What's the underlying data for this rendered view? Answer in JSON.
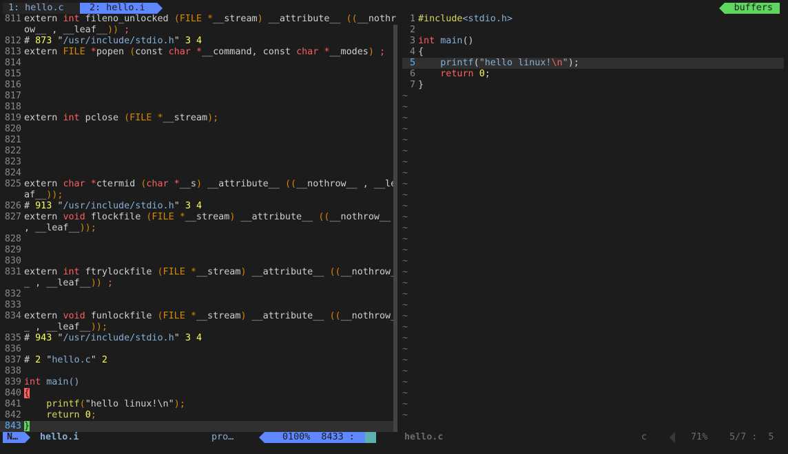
{
  "tabline": {
    "tab1": "1: hello.c",
    "tab2": "2: hello.i",
    "buffers": "buffers"
  },
  "left": {
    "lines": [
      {
        "n": "811",
        "segs": [
          [
            "id",
            "extern "
          ],
          [
            "ty",
            "int"
          ],
          [
            "id",
            " fileno_unlocked "
          ],
          [
            "paren",
            "(FILE *"
          ],
          [
            "id",
            "__stream"
          ],
          [
            "paren",
            ")"
          ],
          [
            "id",
            " __attribute__ "
          ],
          [
            "paren",
            "(("
          ],
          [
            "id",
            "__nothr"
          ]
        ]
      },
      {
        "n": "",
        "segs": [
          [
            "id",
            "ow__ , __leaf__"
          ],
          [
            "paren",
            "))"
          ],
          [
            "ty",
            " ;"
          ]
        ]
      },
      {
        "n": "812",
        "segs": [
          [
            "id",
            "# "
          ],
          [
            "num-lit",
            "873"
          ],
          [
            "id",
            " \""
          ],
          [
            "str",
            "/usr/include/stdio.h"
          ],
          [
            "id",
            "\" "
          ],
          [
            "num-lit",
            "3"
          ],
          [
            "id",
            " "
          ],
          [
            "num-lit",
            "4"
          ]
        ]
      },
      {
        "n": "813",
        "segs": [
          [
            "id",
            "extern "
          ],
          [
            "paren",
            "FILE"
          ],
          [
            "ty",
            " *"
          ],
          [
            "id",
            "popen "
          ],
          [
            "paren",
            "("
          ],
          [
            "id",
            "const "
          ],
          [
            "ty",
            "char"
          ],
          [
            "ty",
            " *"
          ],
          [
            "id",
            "__command, const "
          ],
          [
            "ty",
            "char"
          ],
          [
            "ty",
            " *"
          ],
          [
            "id",
            "__modes"
          ],
          [
            "paren",
            ")"
          ],
          [
            "ty",
            " ;"
          ]
        ]
      },
      {
        "n": "814",
        "segs": []
      },
      {
        "n": "815",
        "segs": []
      },
      {
        "n": "816",
        "segs": []
      },
      {
        "n": "817",
        "segs": []
      },
      {
        "n": "818",
        "segs": []
      },
      {
        "n": "819",
        "segs": [
          [
            "id",
            "extern "
          ],
          [
            "ty",
            "int"
          ],
          [
            "id",
            " pclose "
          ],
          [
            "paren",
            "(FILE *"
          ],
          [
            "id",
            "__stream"
          ],
          [
            "paren",
            ");"
          ]
        ]
      },
      {
        "n": "820",
        "segs": []
      },
      {
        "n": "821",
        "segs": []
      },
      {
        "n": "822",
        "segs": []
      },
      {
        "n": "823",
        "segs": []
      },
      {
        "n": "824",
        "segs": []
      },
      {
        "n": "825",
        "segs": [
          [
            "id",
            "extern "
          ],
          [
            "ty",
            "char"
          ],
          [
            "ty",
            " *"
          ],
          [
            "id",
            "ctermid "
          ],
          [
            "paren",
            "("
          ],
          [
            "ty",
            "char"
          ],
          [
            "ty",
            " *"
          ],
          [
            "id",
            "__s"
          ],
          [
            "paren",
            ")"
          ],
          [
            "id",
            " __attribute__ "
          ],
          [
            "paren",
            "(("
          ],
          [
            "id",
            "__nothrow__ , __le"
          ]
        ]
      },
      {
        "n": "",
        "segs": [
          [
            "id",
            "af__"
          ],
          [
            "paren",
            "));"
          ]
        ]
      },
      {
        "n": "826",
        "segs": [
          [
            "id",
            "# "
          ],
          [
            "num-lit",
            "913"
          ],
          [
            "id",
            " \""
          ],
          [
            "str",
            "/usr/include/stdio.h"
          ],
          [
            "id",
            "\" "
          ],
          [
            "num-lit",
            "3"
          ],
          [
            "id",
            " "
          ],
          [
            "num-lit",
            "4"
          ]
        ]
      },
      {
        "n": "827",
        "segs": [
          [
            "id",
            "extern "
          ],
          [
            "ty",
            "void"
          ],
          [
            "id",
            " flockfile "
          ],
          [
            "paren",
            "(FILE *"
          ],
          [
            "id",
            "__stream"
          ],
          [
            "paren",
            ")"
          ],
          [
            "id",
            " __attribute__ "
          ],
          [
            "paren",
            "(("
          ],
          [
            "id",
            "__nothrow__"
          ]
        ]
      },
      {
        "n": "",
        "segs": [
          [
            "id",
            ", __leaf__"
          ],
          [
            "paren",
            "));"
          ]
        ]
      },
      {
        "n": "828",
        "segs": []
      },
      {
        "n": "829",
        "segs": []
      },
      {
        "n": "830",
        "segs": []
      },
      {
        "n": "831",
        "segs": [
          [
            "id",
            "extern "
          ],
          [
            "ty",
            "int"
          ],
          [
            "id",
            " ftrylockfile "
          ],
          [
            "paren",
            "(FILE *"
          ],
          [
            "id",
            "__stream"
          ],
          [
            "paren",
            ")"
          ],
          [
            "id",
            " __attribute__ "
          ],
          [
            "paren",
            "(("
          ],
          [
            "id",
            "__nothrow_"
          ]
        ]
      },
      {
        "n": "",
        "segs": [
          [
            "id",
            "_ , __leaf__"
          ],
          [
            "paren",
            "))"
          ],
          [
            "ty",
            " ;"
          ]
        ]
      },
      {
        "n": "832",
        "segs": []
      },
      {
        "n": "833",
        "segs": []
      },
      {
        "n": "834",
        "segs": [
          [
            "id",
            "extern "
          ],
          [
            "ty",
            "void"
          ],
          [
            "id",
            " funlockfile "
          ],
          [
            "paren",
            "(FILE *"
          ],
          [
            "id",
            "__stream"
          ],
          [
            "paren",
            ")"
          ],
          [
            "id",
            " __attribute__ "
          ],
          [
            "paren",
            "(("
          ],
          [
            "id",
            "__nothrow_"
          ]
        ]
      },
      {
        "n": "",
        "segs": [
          [
            "id",
            "_ , __leaf__"
          ],
          [
            "paren",
            "));"
          ]
        ]
      },
      {
        "n": "835",
        "segs": [
          [
            "id",
            "# "
          ],
          [
            "num-lit",
            "943"
          ],
          [
            "id",
            " \""
          ],
          [
            "str",
            "/usr/include/stdio.h"
          ],
          [
            "id",
            "\" "
          ],
          [
            "num-lit",
            "3"
          ],
          [
            "id",
            " "
          ],
          [
            "num-lit",
            "4"
          ]
        ]
      },
      {
        "n": "836",
        "segs": []
      },
      {
        "n": "837",
        "segs": [
          [
            "id",
            "# "
          ],
          [
            "num-lit",
            "2"
          ],
          [
            "id",
            " \""
          ],
          [
            "str",
            "hello.c"
          ],
          [
            "id",
            "\" "
          ],
          [
            "num-lit",
            "2"
          ]
        ]
      },
      {
        "n": "838",
        "segs": []
      },
      {
        "n": "839",
        "segs": [
          [
            "ty",
            "int"
          ],
          [
            "fn",
            " main()"
          ]
        ]
      },
      {
        "n": "840",
        "segs": [
          [
            "brace-hl-red",
            "{"
          ]
        ]
      },
      {
        "n": "841",
        "segs": [
          [
            "yellow",
            "    printf"
          ],
          [
            "paren",
            "("
          ],
          [
            "id",
            "\"hello linux!\\n\""
          ],
          [
            "paren",
            ");"
          ]
        ]
      },
      {
        "n": "842",
        "segs": [
          [
            "yellow",
            "    return "
          ],
          [
            "num-lit",
            "0"
          ],
          [
            "paren",
            ";"
          ]
        ]
      },
      {
        "n": "843",
        "segs": [
          [
            "brace-hl-green",
            "}"
          ]
        ],
        "cur": true
      }
    ]
  },
  "right": {
    "lines": [
      {
        "n": "1",
        "segs": [
          [
            "yellow",
            "#include"
          ],
          [
            "str",
            "<stdio.h>"
          ]
        ]
      },
      {
        "n": "2",
        "segs": []
      },
      {
        "n": "3",
        "segs": [
          [
            "ty",
            "int"
          ],
          [
            "fn",
            " main"
          ],
          [
            "id",
            "()"
          ]
        ]
      },
      {
        "n": "4",
        "segs": [
          [
            "id",
            "{"
          ]
        ]
      },
      {
        "n": "5",
        "segs": [
          [
            "fn",
            "    printf"
          ],
          [
            "id",
            "("
          ],
          [
            "str",
            "\"hello linux!"
          ],
          [
            "ty",
            "\\n"
          ],
          [
            "str",
            "\""
          ],
          [
            "id",
            ");"
          ]
        ],
        "cur": true
      },
      {
        "n": "6",
        "segs": [
          [
            "ty",
            "    return "
          ],
          [
            "num-lit",
            "0"
          ],
          [
            "id",
            ";"
          ]
        ]
      },
      {
        "n": "7",
        "segs": [
          [
            "id",
            "}"
          ]
        ]
      }
    ],
    "tilde_count": 30,
    "tilde": "~"
  },
  "status": {
    "mode": "N…",
    "file": "hello.i",
    "filetype": "pro…",
    "position": "0100%  8433 :  1",
    "col": "",
    "r_file": "hello.c",
    "r_filetype": "c",
    "r_pct": "71%",
    "r_pos": "5/7 :  5"
  }
}
